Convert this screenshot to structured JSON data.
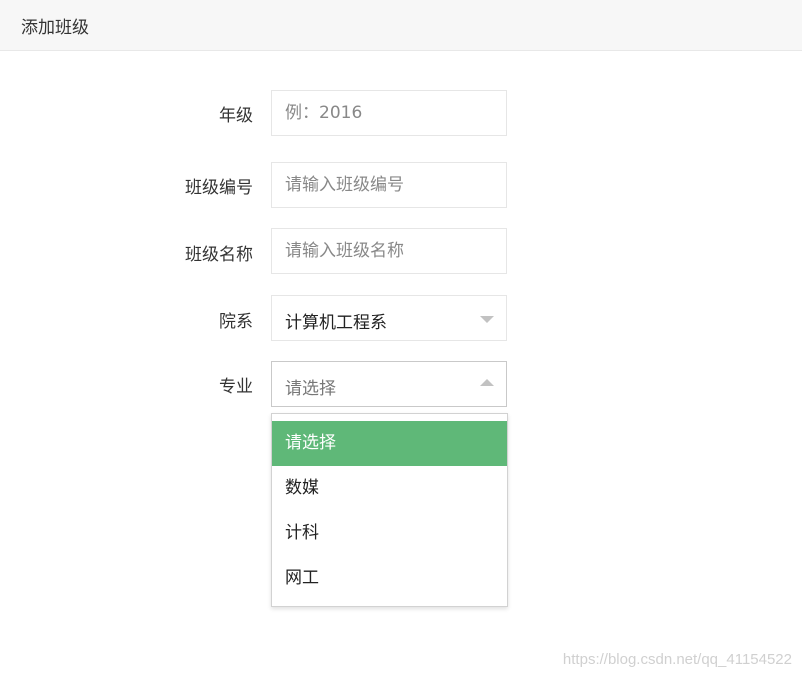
{
  "header": {
    "title": "添加班级"
  },
  "form": {
    "grade": {
      "label": "年级",
      "placeholder": "例：2016"
    },
    "class_code": {
      "label": "班级编号",
      "placeholder": "请输入班级编号"
    },
    "class_name": {
      "label": "班级名称",
      "placeholder": "请输入班级名称"
    },
    "department": {
      "label": "院系",
      "value": "计算机工程系",
      "icon": "caret-down-icon"
    },
    "major": {
      "label": "专业",
      "value": "请选择",
      "icon": "caret-up-icon",
      "options": [
        "请选择",
        "数媒",
        "计科",
        "网工"
      ],
      "selected_index": 0
    }
  },
  "watermark": "https://blog.csdn.net/qq_41154522",
  "colors": {
    "accent": "#5fb878",
    "header_bg": "#f7f7f7",
    "border": "#e6e6e6"
  }
}
